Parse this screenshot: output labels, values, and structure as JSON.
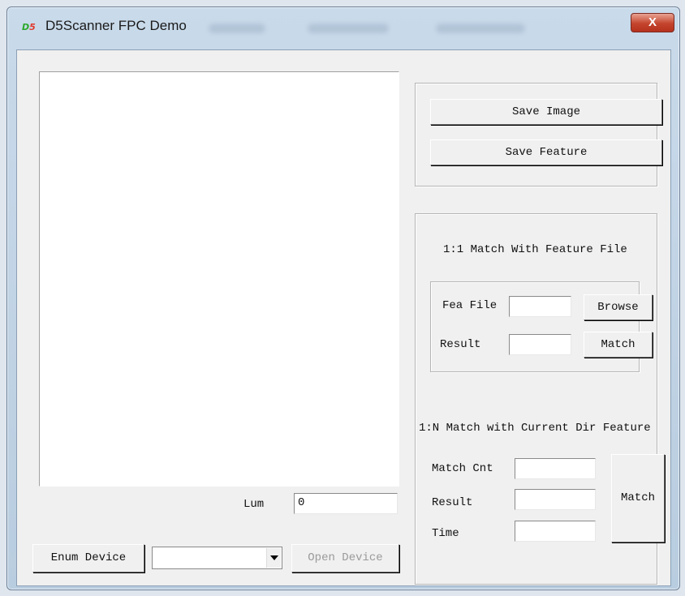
{
  "window": {
    "title": "D5Scanner FPC Demo",
    "icon_text_a": "D",
    "icon_text_b": "5",
    "close_glyph": "X"
  },
  "image_panel": {
    "lum_label": "Lum",
    "lum_value": "0"
  },
  "device": {
    "enum_label": "Enum Device",
    "selected": "",
    "open_label": "Open Device",
    "open_enabled": false
  },
  "save_group": {
    "save_image_label": "Save Image",
    "save_feature_label": "Save Feature"
  },
  "match_group": {
    "one_to_one_title": "1:1 Match With Feature File",
    "fea_file_label": "Fea File",
    "fea_file_value": "",
    "browse_label": "Browse",
    "result_label": "Result",
    "result_value": "",
    "match_label": "Match",
    "one_to_n_title": "1:N Match with Current Dir Feature",
    "match_cnt_label": "Match Cnt",
    "match_cnt_value": "",
    "n_result_label": "Result",
    "n_result_value": "",
    "time_label": "Time",
    "time_value": "",
    "n_match_label": "Match"
  }
}
